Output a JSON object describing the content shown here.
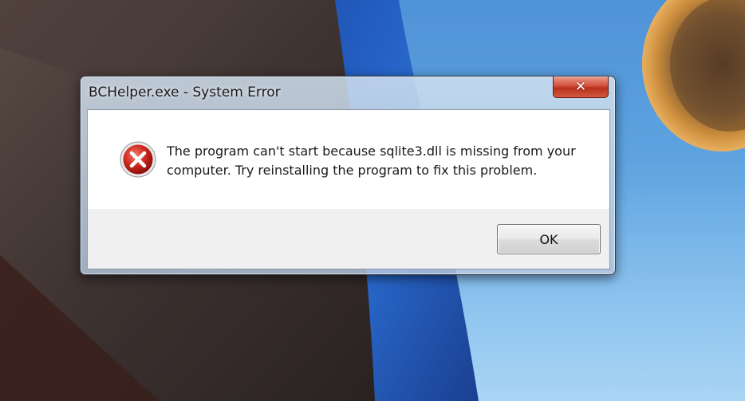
{
  "dialog": {
    "title": "BCHelper.exe - System Error",
    "close_label": "✕",
    "icon": "error-icon",
    "message": "The program can't start because sqlite3.dll is missing from your computer. Try reinstalling the program to fix this problem.",
    "ok_label": "OK"
  },
  "colors": {
    "close_button": "#c94a32",
    "error_icon_red": "#c8201c",
    "sky": "#5ea3e0"
  }
}
